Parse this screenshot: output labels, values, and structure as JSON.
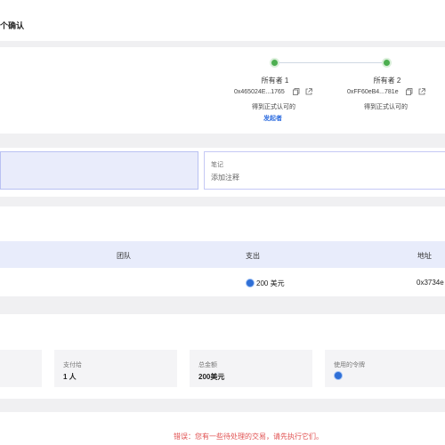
{
  "header": {
    "title": "个确认"
  },
  "owners": [
    {
      "name": "所有者 1",
      "address": "0x465024E...1765",
      "status": "得到正式认可的",
      "role": "发起者"
    },
    {
      "name": "所有者 2",
      "address": "0xFF60eB4...781e",
      "status": "得到正式认可的"
    }
  ],
  "notes": {
    "label": "笔记",
    "placeholder": "添加注释"
  },
  "table": {
    "headers": [
      "团队",
      "支出",
      "地址"
    ],
    "rows": [
      {
        "team": "",
        "amount": "200 美元",
        "address": "0x3734e"
      }
    ]
  },
  "summary": [
    {
      "label": "支付给",
      "value": "1 人"
    },
    {
      "label": "总金额",
      "value": "200美元"
    },
    {
      "label": "使用的令牌",
      "value": ""
    }
  ],
  "error": "错误：您有一些待处理的交易，请先执行它们。",
  "colors": {
    "accent": "#2d6cdf",
    "success": "#4caf50",
    "error": "#e05050",
    "table_header": "#e8ecfb"
  }
}
